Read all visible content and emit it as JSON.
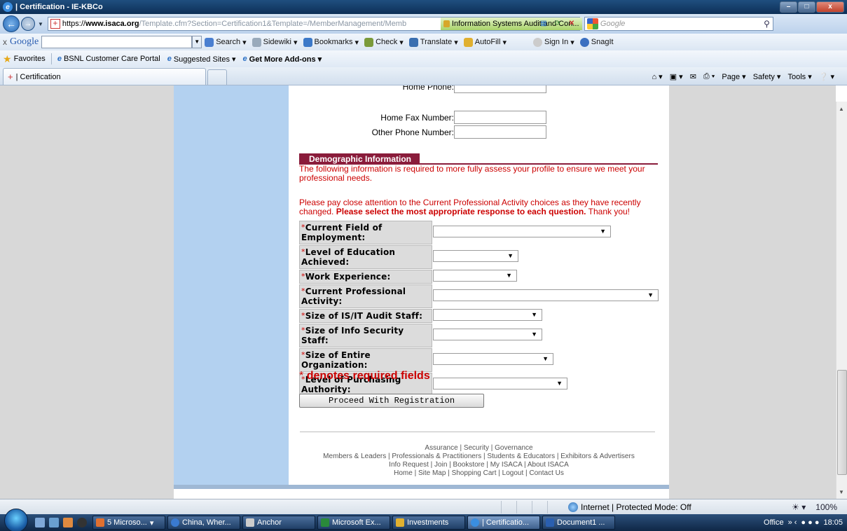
{
  "window": {
    "title": "| Certification - IE-KBCo",
    "minimize": "–",
    "maximize": "□",
    "close": "x"
  },
  "address": {
    "url_protocol": "https://",
    "url_host": "www.isaca.org",
    "url_rest": "/Template.cfm?Section=Certification1&Template=/MemberManagement/Memb",
    "cert_label": "Information Systems Audit and Con...",
    "search_placeholder": "Google"
  },
  "google_toolbar": {
    "logo": "Google",
    "close": "x",
    "items": [
      "Search",
      "Sidewiki",
      "Bookmarks",
      "Check",
      "Translate",
      "AutoFill",
      "Sign In",
      "SnagIt"
    ]
  },
  "favorites_bar": {
    "favorites_label": "Favorites",
    "links": [
      "BSNL Customer Care Portal",
      "Suggested Sites ▾",
      "Get More Add-ons ▾"
    ]
  },
  "tabs": {
    "active_tab": "| Certification",
    "commands": [
      "Page ▾",
      "Safety ▾",
      "Tools ▾"
    ]
  },
  "form": {
    "phone_fields": [
      {
        "label": "Home Phone:"
      },
      {
        "label": "Home Fax Number:"
      },
      {
        "label": "Other Phone Number:"
      }
    ],
    "section_title": "Demographic Information",
    "intro": "The following information is required to more fully assess your profile to ensure we meet your professional needs.",
    "notice_prefix": "Please pay close attention to the Current Professional Activity choices as they have recently changed.",
    "notice_bold": "Please select the most appropriate response to each question.",
    "notice_suffix": "Thank you!",
    "required_mark": "*",
    "questions": [
      {
        "label": "Current Field of Employment:",
        "value": ""
      },
      {
        "label": "Level of Education Achieved:",
        "value": ""
      },
      {
        "label": "Work Experience:",
        "value": ""
      },
      {
        "label": "Current Professional Activity:",
        "value": ""
      },
      {
        "label": "Size of IS/IT Audit Staff:",
        "value": ""
      },
      {
        "label": "Size of Info Security Staff:",
        "value": ""
      },
      {
        "label": "Size of Entire Organization:",
        "value": ""
      },
      {
        "label": "Level of Purchasing Authority:",
        "value": ""
      }
    ],
    "required_note": "denotes required fields",
    "proceed_button": "Proceed With Registration"
  },
  "footer": {
    "line1": "Assurance | Security | Governance",
    "line2": "Members & Leaders | Professionals & Practitioners | Students & Educators | Exhibitors & Advertisers",
    "line3": "Info Request | Join | Bookstore | My ISACA | About ISACA",
    "line4": "Home | Site Map | Shopping Cart | Logout | Contact Us"
  },
  "status": {
    "zone": "Internet | Protected Mode: Off",
    "zoom": "100%"
  },
  "taskbar": {
    "tasks": [
      "5 Microso...",
      "China, Wher...",
      "Anchor",
      "Microsoft Ex...",
      "Investments",
      "| Certificatio...",
      "Document1 ..."
    ],
    "office_label": "Office",
    "time": "18:05"
  }
}
